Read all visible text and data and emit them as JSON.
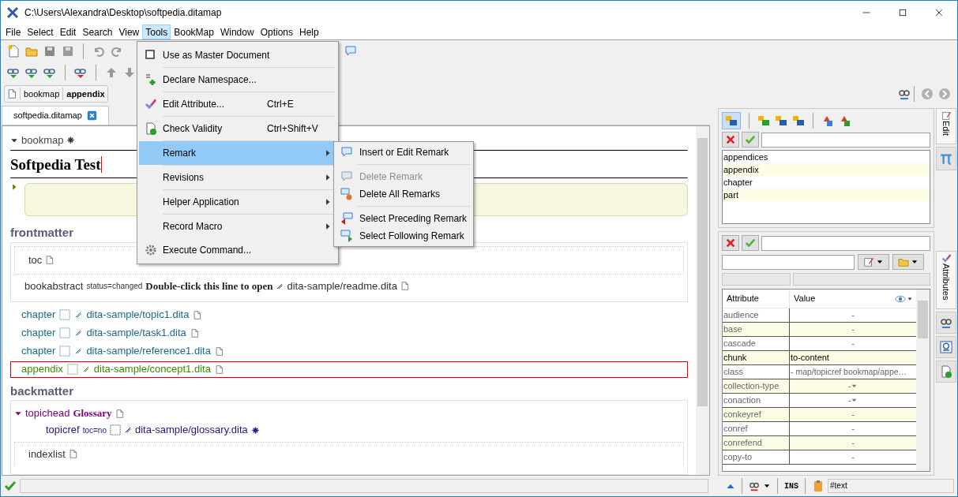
{
  "window": {
    "title": "C:\\Users\\Alexandra\\Desktop\\softpedia.ditamap"
  },
  "menu_bar": [
    {
      "label": "File",
      "selected": false
    },
    {
      "label": "Select",
      "selected": false
    },
    {
      "label": "Edit",
      "selected": false
    },
    {
      "label": "Search",
      "selected": false
    },
    {
      "label": "View",
      "selected": false
    },
    {
      "label": "Tools",
      "selected": true
    },
    {
      "label": "BookMap",
      "selected": false
    },
    {
      "label": "Window",
      "selected": false
    },
    {
      "label": "Options",
      "selected": false
    },
    {
      "label": "Help",
      "selected": false
    }
  ],
  "tools_menu": [
    {
      "kind": "check",
      "label": "Use as Master Document",
      "checked": false,
      "selected": false
    },
    {
      "kind": "item",
      "label": "Declare Namespace...",
      "selected": false
    },
    {
      "kind": "item",
      "label": "Edit Attribute...",
      "shortcut": "Ctrl+E",
      "selected": false
    },
    {
      "kind": "item",
      "label": "Check Validity",
      "shortcut": "Ctrl+Shift+V",
      "selected": false
    },
    {
      "kind": "submenu",
      "label": "Remark",
      "selected": true
    },
    {
      "kind": "submenu",
      "label": "Revisions",
      "selected": false
    },
    {
      "kind": "submenu",
      "label": "Helper Application",
      "selected": false
    },
    {
      "kind": "submenu",
      "label": "Record Macro",
      "selected": false
    },
    {
      "kind": "item",
      "label": "Execute Command...",
      "selected": false
    }
  ],
  "remark_menu": [
    {
      "label": "Insert or Edit Remark",
      "disabled": false
    },
    {
      "label": "Delete Remark",
      "disabled": true
    },
    {
      "label": "Delete All Remarks",
      "disabled": false
    },
    {
      "label": "Select Preceding Remark",
      "disabled": false
    },
    {
      "label": "Select Following Remark",
      "disabled": false
    }
  ],
  "breadcrumb": [
    "bookmap",
    "appendix"
  ],
  "editor_tab": {
    "label": "softpedia.ditamap"
  },
  "document": {
    "root": "bookmap",
    "title": "Softpedia Test",
    "frontmatter": {
      "heading": "frontmatter",
      "toc": "toc",
      "abstract": {
        "element": "bookabstract",
        "attribute": "status=changed",
        "hint": "Double-click this line to open",
        "href": "dita-sample/readme.dita"
      }
    },
    "refs": [
      {
        "element": "chapter",
        "href": "dita-sample/topic1.dita",
        "selected": false
      },
      {
        "element": "chapter",
        "href": "dita-sample/task1.dita",
        "selected": false
      },
      {
        "element": "chapter",
        "href": "dita-sample/reference1.dita",
        "selected": false
      },
      {
        "element": "appendix",
        "href": "dita-sample/concept1.dita",
        "selected": true
      }
    ],
    "backmatter": {
      "heading": "backmatter",
      "topichead": {
        "element": "topichead",
        "title": "Glossary",
        "expanded": true,
        "child": {
          "element": "topicref",
          "attribute": "toc=no",
          "href": "dita-sample/glossary.dita"
        }
      },
      "indexlist": "indexlist"
    }
  },
  "elements_panel": {
    "items": [
      "appendices",
      "appendix",
      "chapter",
      "part"
    ]
  },
  "side_tabs_top": [
    {
      "label": "Edit",
      "selected": true
    }
  ],
  "attributes_panel": {
    "side_tab": "Attributes",
    "columns": [
      "Attribute",
      "Value"
    ],
    "rows": [
      {
        "name": "audience",
        "value": "-",
        "set": false,
        "kind": "text"
      },
      {
        "name": "base",
        "value": "-",
        "set": false,
        "kind": "text"
      },
      {
        "name": "cascade",
        "value": "-",
        "set": false,
        "kind": "text"
      },
      {
        "name": "chunk",
        "value": "to-content",
        "set": true,
        "kind": "text"
      },
      {
        "name": "class",
        "value": "- map/topicref bookmap/appe…",
        "set": false,
        "kind": "fixed"
      },
      {
        "name": "collection-type",
        "value": "-",
        "set": false,
        "kind": "choice"
      },
      {
        "name": "conaction",
        "value": "-",
        "set": false,
        "kind": "choice"
      },
      {
        "name": "conkeyref",
        "value": "-",
        "set": false,
        "kind": "text"
      },
      {
        "name": "conref",
        "value": "-",
        "set": false,
        "kind": "text"
      },
      {
        "name": "conrefend",
        "value": "-",
        "set": false,
        "kind": "text"
      },
      {
        "name": "copy-to",
        "value": "-",
        "set": false,
        "kind": "text"
      }
    ]
  },
  "status_bar": {
    "mode": "INS",
    "path": "#text"
  }
}
